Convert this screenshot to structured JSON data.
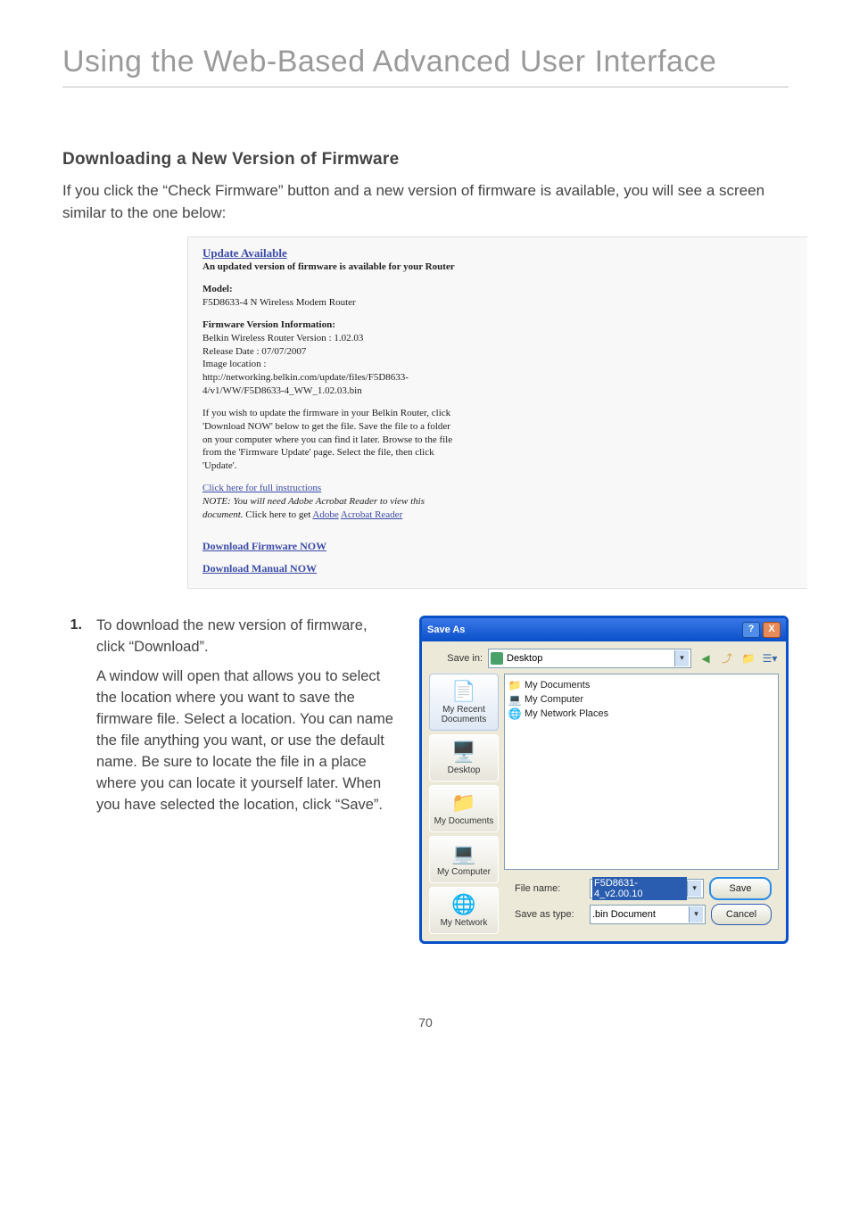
{
  "page": {
    "title": "Using the Web-Based Advanced User Interface",
    "number": "70"
  },
  "section": {
    "heading": "Downloading a New Version of Firmware",
    "intro": "If you click the “Check Firmware” button and a new version of firmware is available, you will see a screen similar to the one below:"
  },
  "popup": {
    "title": "Update Available",
    "sub1": "An updated version of firmware is available for your Router",
    "model_label": "Model:",
    "model_value": "F5D8633-4 N Wireless Modem Router",
    "fvi_label": "Firmware Version Information:",
    "fvi_line1": "Belkin Wireless Router Version : 1.02.03",
    "fvi_line2": "Release Date : 07/07/2007",
    "fvi_line3": "Image location :",
    "fvi_url": "http://networking.belkin.com/update/files/F5D8633-4/v1/WW/F5D8633-4_WW_1.02.03.bin",
    "para": "If you wish to update the firmware in your Belkin Router, click 'Download NOW' below to get the file. Save the file to a folder on your computer where you can find it later. Browse to the file from the 'Firmware Update' page. Select the file, then click 'Update'.",
    "instr_link": "Click here for full instructions",
    "note_pre": "NOTE: You will need Adobe Acrobat Reader to view this document.",
    "note_mid": " Click here to get ",
    "note_link1": "Adobe",
    "note_link2": "Acrobat Reader",
    "dl_fw": "Download Firmware NOW",
    "dl_man": "Download Manual NOW"
  },
  "step1": {
    "num": "1.",
    "p1": "To download the new version of firmware, click “Download”.",
    "p2": "A window will open that allows you to select the location where you want to save the firmware file. Select a location. You can name the file anything you want, or use the default name. Be sure to locate the file in a place where you can locate it yourself later. When you have selected the location, click “Save”."
  },
  "saveas": {
    "title": "Save As",
    "help": "?",
    "close": "X",
    "savein_label": "Save in:",
    "savein_value": "Desktop",
    "places": {
      "recent": "My Recent Documents",
      "desktop": "Desktop",
      "mydocs": "My Documents",
      "mycomp": "My Computer",
      "mynet": "My Network"
    },
    "folders": {
      "mydocs": "My Documents",
      "mycomp": "My Computer",
      "mynet": "My Network Places"
    },
    "filename_label": "File name:",
    "filename_value": "F5D8631-4_v2.00.10",
    "saveastype_label": "Save as type:",
    "saveastype_value": ".bin Document",
    "save_btn": "Save",
    "cancel_btn": "Cancel"
  }
}
